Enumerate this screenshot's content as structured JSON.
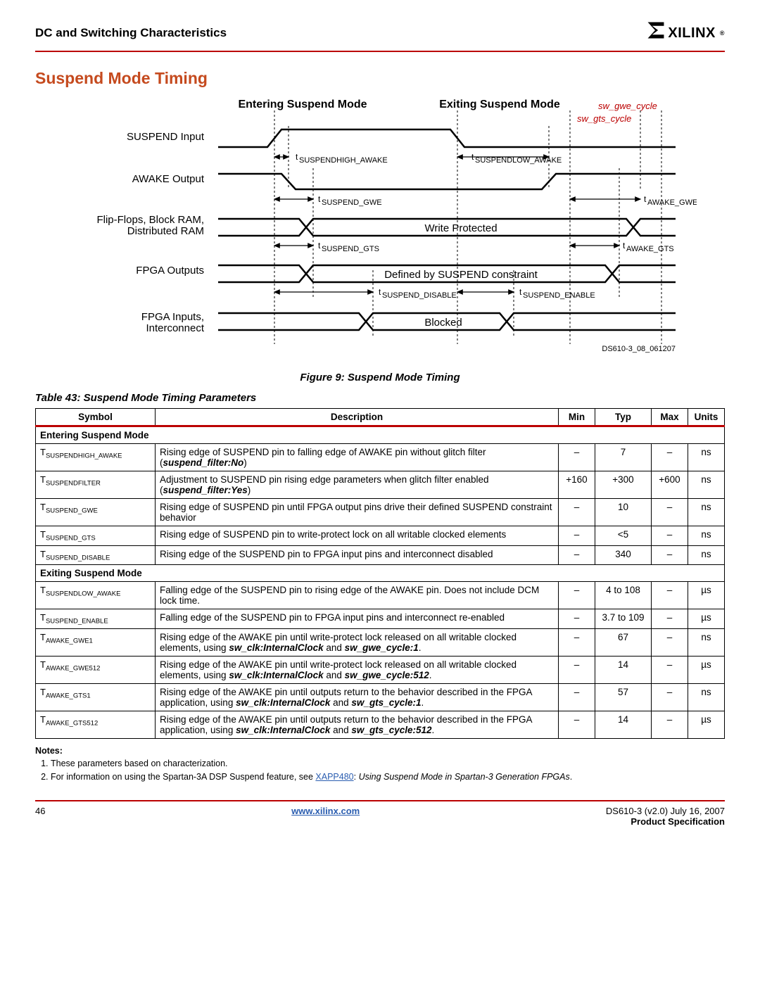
{
  "header": {
    "title": "DC and Switching Characteristics",
    "brand": "XILINX",
    "reg": "®"
  },
  "section_title": "Suspend Mode Timing",
  "diagram": {
    "mode_entering": "Entering Suspend Mode",
    "mode_exiting": "Exiting Suspend Mode",
    "labels": {
      "suspend_input": "SUSPEND Input",
      "awake_output": "AWAKE Output",
      "ff_block_ram": "Flip-Flops, Block RAM,",
      "dist_ram": "Distributed RAM",
      "fpga_outputs": "FPGA Outputs",
      "fpga_inputs": "FPGA Inputs,",
      "interconnect": "Interconnect",
      "write_protected": "Write Protected",
      "defined_by": "Defined by SUSPEND constraint",
      "blocked": "Blocked",
      "sw_gwe": "sw_gwe_cycle",
      "sw_gts": "sw_gts_cycle",
      "small_id": "DS610-3_08_061207"
    },
    "ann": {
      "t_suspendhigh_awake": "SUSPENDHIGH_AWAKE",
      "t_suspendlow_awake": "SUSPENDLOW_AWAKE",
      "t_suspend_gwe": "SUSPEND_GWE",
      "t_awake_gwe": "AWAKE_GWE",
      "t_suspend_gts": "SUSPEND_GTS",
      "t_awake_gts": "AWAKE_GTS",
      "t_suspend_disable": "SUSPEND_DISABLE",
      "t_suspend_enable": "SUSPEND_ENABLE"
    }
  },
  "figure_caption": "Figure 9:  Suspend Mode Timing",
  "table_caption": "Table  43:  Suspend Mode Timing Parameters",
  "table": {
    "headers": {
      "symbol": "Symbol",
      "description": "Description",
      "min": "Min",
      "typ": "Typ",
      "max": "Max",
      "units": "Units"
    },
    "section1": "Entering Suspend Mode",
    "section2": "Exiting Suspend Mode",
    "rows1": [
      {
        "sym_main": "T",
        "sym_sub": "SUSPENDHIGH_AWAKE",
        "desc": "Rising edge of SUSPEND pin to falling edge of AWAKE pin without glitch filter (",
        "desc_bi": "suspend_filter:No",
        "desc_tail": ")",
        "min": "–",
        "typ": "7",
        "max": "–",
        "units": "ns"
      },
      {
        "sym_main": "T",
        "sym_sub": "SUSPENDFILTER",
        "desc": "Adjustment to SUSPEND pin rising edge parameters when glitch filter enabled (",
        "desc_bi": "suspend_filter:Yes",
        "desc_tail": ")",
        "min": "+160",
        "typ": "+300",
        "max": "+600",
        "units": "ns"
      },
      {
        "sym_main": "T",
        "sym_sub": "SUSPEND_GWE",
        "desc": "Rising edge of SUSPEND pin until FPGA output pins drive their defined SUSPEND constraint behavior",
        "desc_bi": "",
        "desc_tail": "",
        "min": "–",
        "typ": "10",
        "max": "–",
        "units": "ns"
      },
      {
        "sym_main": "T",
        "sym_sub": "SUSPEND_GTS",
        "desc": "Rising edge of SUSPEND pin to write-protect lock on all writable clocked elements",
        "desc_bi": "",
        "desc_tail": "",
        "min": "–",
        "typ": "<5",
        "max": "–",
        "units": "ns"
      },
      {
        "sym_main": "T",
        "sym_sub": "SUSPEND_DISABLE",
        "desc": "Rising edge of the SUSPEND pin to FPGA input pins and interconnect disabled",
        "desc_bi": "",
        "desc_tail": "",
        "min": "–",
        "typ": "340",
        "max": "–",
        "units": "ns"
      }
    ],
    "rows2": [
      {
        "sym_main": "T",
        "sym_sub": "SUSPENDLOW_AWAKE",
        "desc": "Falling edge of the SUSPEND pin to rising edge of the AWAKE pin. Does not include DCM lock time.",
        "desc_bi": "",
        "desc_tail": "",
        "min": "–",
        "typ": "4 to 108",
        "max": "–",
        "units": "µs"
      },
      {
        "sym_main": "T",
        "sym_sub": "SUSPEND_ENABLE",
        "desc": "Falling edge of the SUSPEND pin to FPGA input pins and interconnect re-enabled",
        "desc_bi": "",
        "desc_tail": "",
        "min": "–",
        "typ": "3.7 to 109",
        "max": "–",
        "units": "µs"
      },
      {
        "sym_main": "T",
        "sym_sub": "AWAKE_GWE1",
        "desc": "Rising edge of the AWAKE pin until write-protect lock released on all writable clocked elements, using ",
        "desc_bi": "sw_clk:InternalClock",
        "desc_mid": " and ",
        "desc_bi2": "sw_gwe_cycle:1",
        "desc_tail": ".",
        "min": "–",
        "typ": "67",
        "max": "–",
        "units": "ns"
      },
      {
        "sym_main": "T",
        "sym_sub": "AWAKE_GWE512",
        "desc": "Rising edge of the AWAKE pin until write-protect lock released on all writable clocked elements, using ",
        "desc_bi": "sw_clk:InternalClock",
        "desc_mid": " and ",
        "desc_bi2": "sw_gwe_cycle:512",
        "desc_tail": ".",
        "min": "–",
        "typ": "14",
        "max": "–",
        "units": "µs"
      },
      {
        "sym_main": "T",
        "sym_sub": "AWAKE_GTS1",
        "desc": "Rising edge of the AWAKE pin until outputs return to the behavior described in the FPGA application, using ",
        "desc_bi": "sw_clk:InternalClock",
        "desc_mid": " and ",
        "desc_bi2": "sw_gts_cycle:1",
        "desc_tail": ".",
        "min": "–",
        "typ": "57",
        "max": "–",
        "units": "ns"
      },
      {
        "sym_main": "T",
        "sym_sub": "AWAKE_GTS512",
        "desc": "Rising edge of the AWAKE pin until outputs return to the behavior described in the FPGA application, using ",
        "desc_bi": "sw_clk:InternalClock",
        "desc_mid": " and ",
        "desc_bi2": "sw_gts_cycle:512",
        "desc_tail": ".",
        "min": "–",
        "typ": "14",
        "max": "–",
        "units": "µs"
      }
    ]
  },
  "notes": {
    "title": "Notes:",
    "items": [
      {
        "text": "These parameters based on characterization."
      },
      {
        "text_pre": "For information on using the Spartan-3A DSP Suspend feature, see ",
        "link": "XAPP480",
        "text_post": ": ",
        "italic": "Using Suspend Mode in Spartan-3 Generation FPGAs",
        "text_end": "."
      }
    ]
  },
  "footer": {
    "page": "46",
    "url": "www.xilinx.com",
    "doc": "DS610-3 (v2.0) July 16, 2007",
    "spec": "Product Specification"
  }
}
